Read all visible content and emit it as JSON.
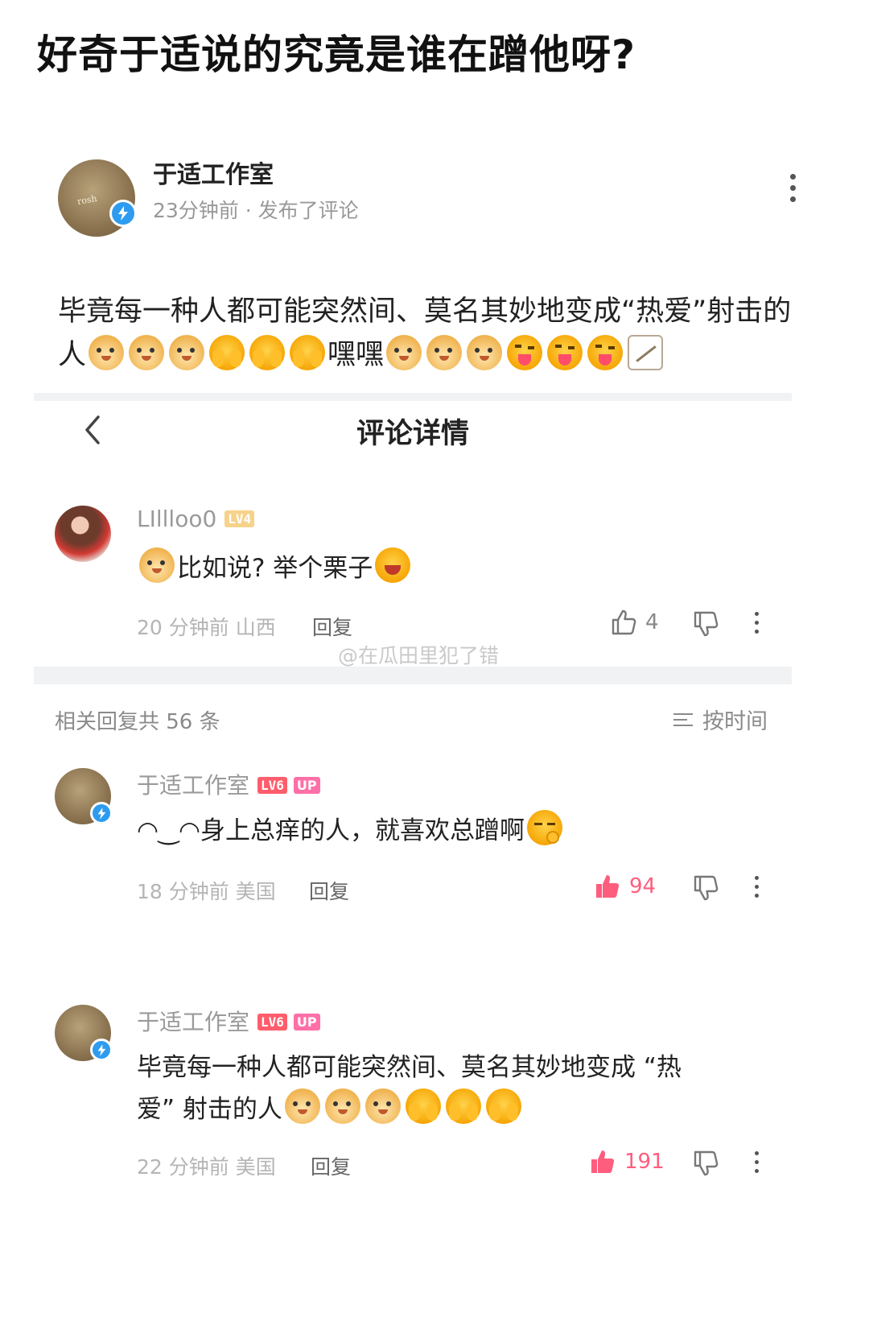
{
  "headline": "好奇于适说的究竟是谁在蹭他呀?",
  "post": {
    "author": "于适工作室",
    "meta": "23分钟前 · 发布了评论",
    "text": "毕竟每一种人都可能突然间、莫名其妙地变成“热爱”射击的人",
    "laugh_text": "嘿嘿",
    "avatar_text": "rosh"
  },
  "detail": {
    "title": "评论详情"
  },
  "main_comment": {
    "author": "LIllloo0",
    "level": "LV4",
    "text": "比如说? 举个栗子",
    "meta": "20 分钟前 山西",
    "reply": "回复",
    "likes": "4"
  },
  "watermark": "@在瓜田里犯了错",
  "replies_header": {
    "count_text": "相关回复共 56 条",
    "sort": "按时间"
  },
  "replies": [
    {
      "author": "于适工作室",
      "level": "LV6",
      "badge": "UP",
      "prefix": "◠‿◠",
      "text": "身上总痒的人，就喜欢总蹭啊",
      "meta": "18 分钟前 美国",
      "reply": "回复",
      "likes": "94"
    },
    {
      "author": "于适工作室",
      "level": "LV6",
      "badge": "UP",
      "text_line1": "毕竟每一种人都可能突然间、莫名其妙地变成 “热",
      "text_line2": "爱” 射击的人",
      "meta": "22 分钟前 美国",
      "reply": "回复",
      "likes": "191"
    }
  ],
  "colors": {
    "accent_pink": "#ff5d7d",
    "verify_blue": "#2d9cf0",
    "level_red": "#ff5d6c",
    "up_pink": "#ff6fa8"
  },
  "icons": [
    "verify-icon",
    "more-icon",
    "back-icon",
    "thumb-up-icon",
    "thumb-down-icon",
    "sort-icon"
  ]
}
